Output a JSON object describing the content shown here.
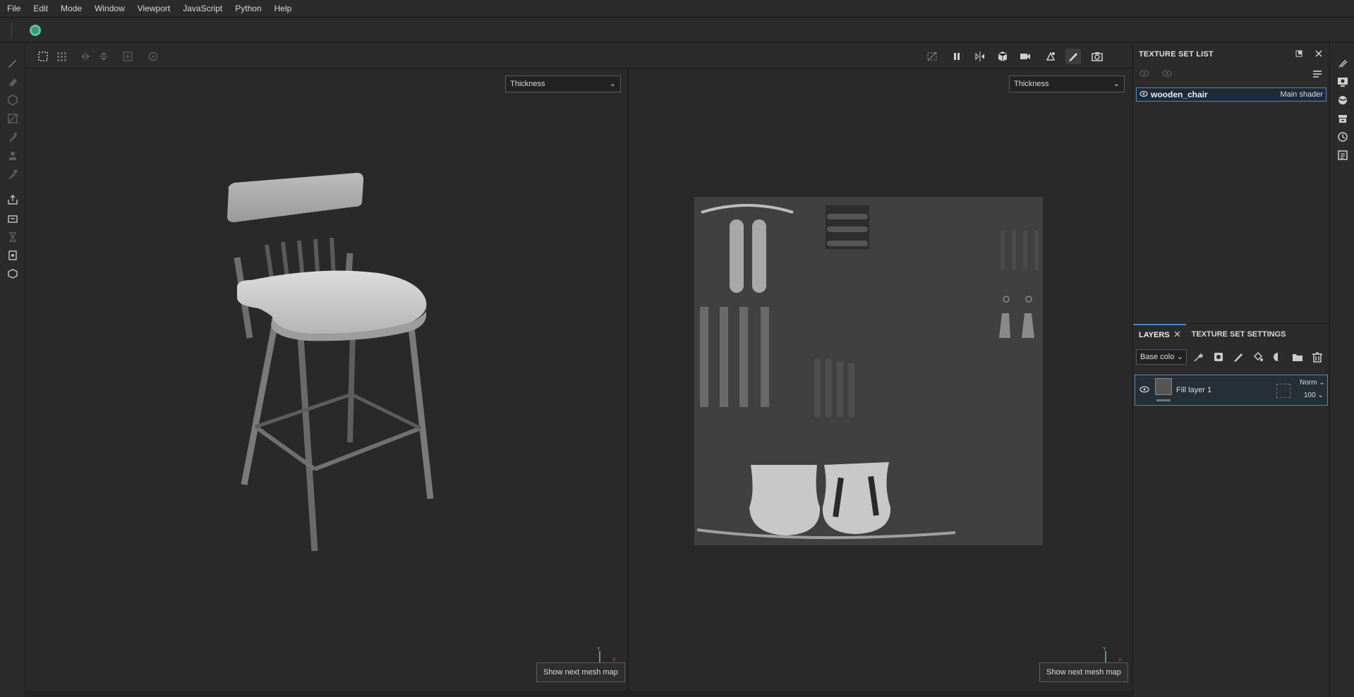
{
  "menu": [
    "File",
    "Edit",
    "Mode",
    "Window",
    "Viewport",
    "JavaScript",
    "Python",
    "Help"
  ],
  "viewport3d": {
    "channel": "Thickness",
    "mesh_button": "Show next mesh map",
    "gizmo": {
      "y": "Y",
      "x": "X"
    }
  },
  "viewport2d": {
    "channel": "Thickness",
    "mesh_button": "Show next mesh map",
    "gizmo": {
      "y": "Y",
      "x": "U"
    }
  },
  "texture_set_list": {
    "title": "TEXTURE SET LIST",
    "items": [
      {
        "name": "wooden_chair",
        "shader": "Main shader"
      }
    ]
  },
  "layers": {
    "tabs": [
      "LAYERS",
      "TEXTURE SET SETTINGS"
    ],
    "channel": "Base colo",
    "items": [
      {
        "name": "Fill layer 1",
        "blend": "Norm",
        "opacity": "100"
      }
    ]
  },
  "colors": {
    "accent": "#4f86c7",
    "plugin": "#2f9c73"
  }
}
